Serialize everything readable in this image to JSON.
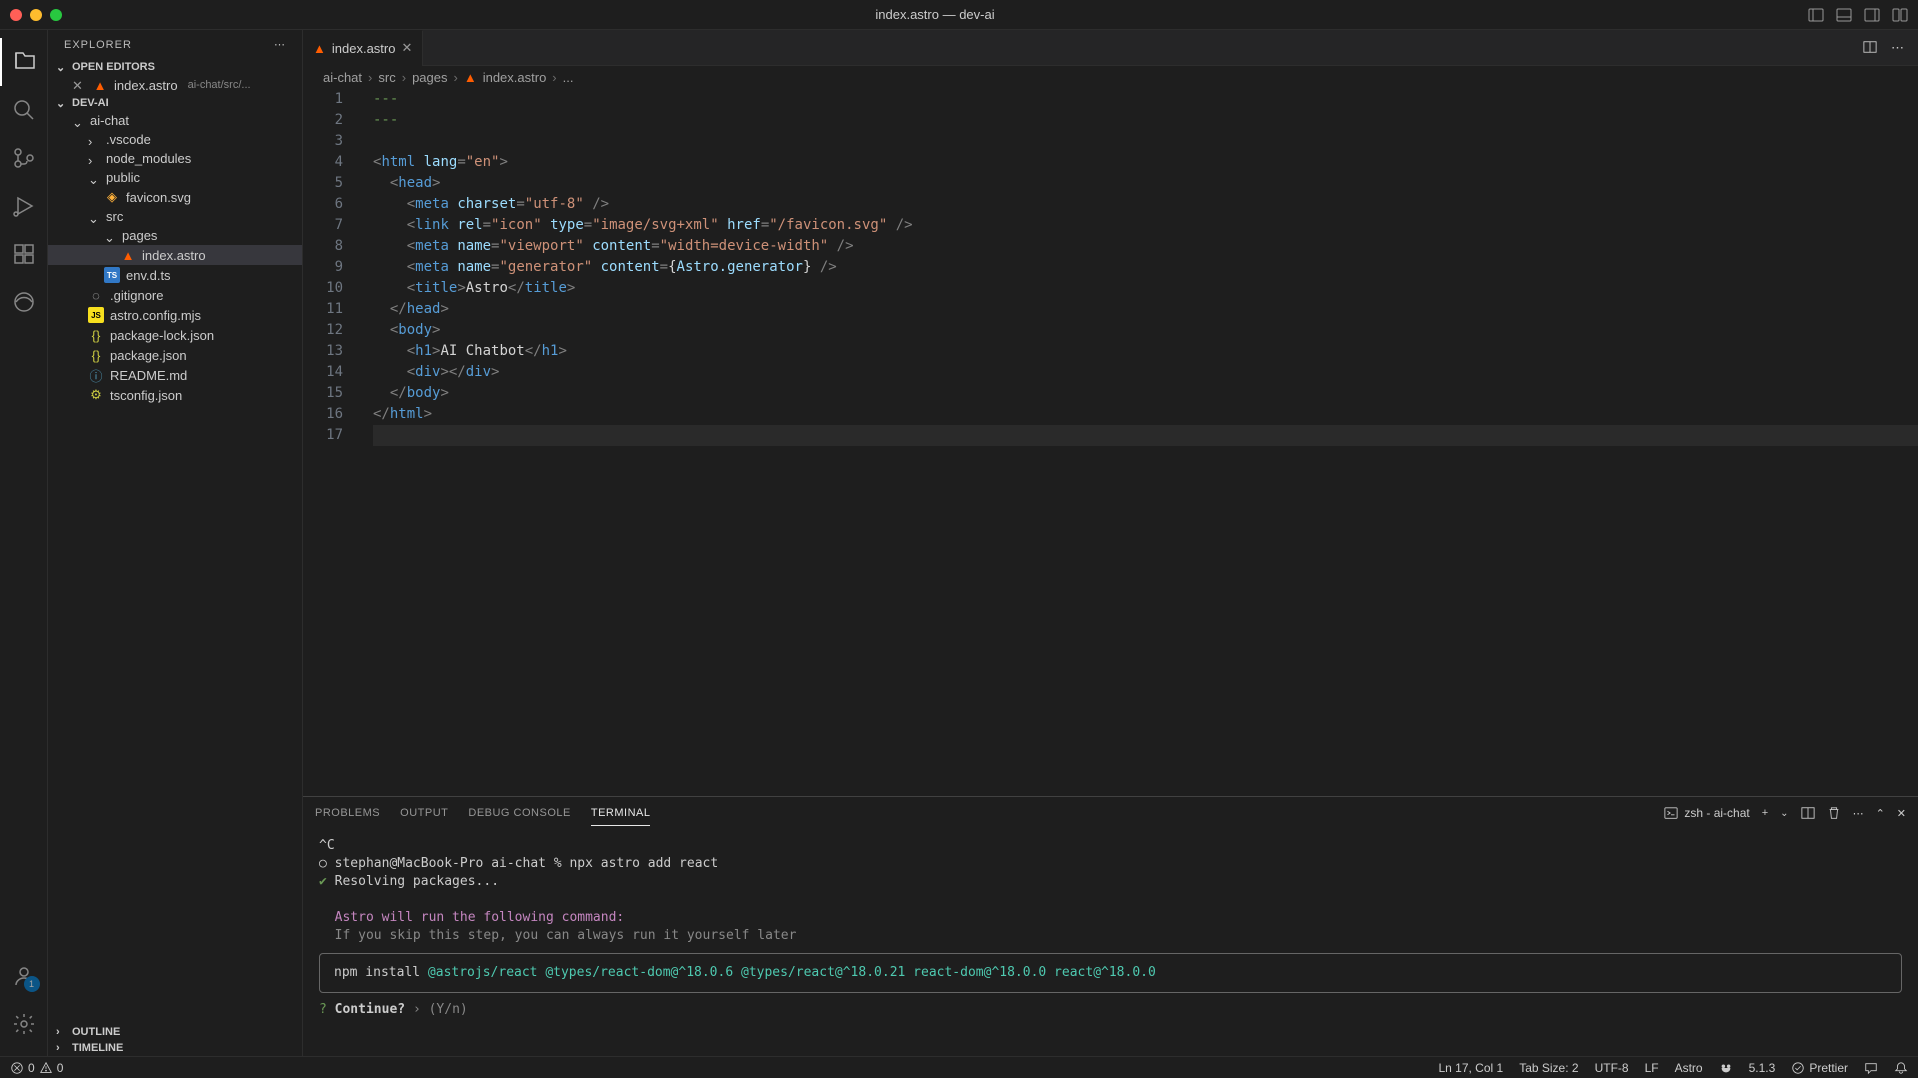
{
  "titlebar": {
    "title": "index.astro — dev-ai"
  },
  "sidebar": {
    "title": "EXPLORER",
    "sections": {
      "open_editors": {
        "label": "OPEN EDITORS",
        "items": [
          {
            "name": "index.astro",
            "path": "ai-chat/src/..."
          }
        ]
      },
      "project": {
        "label": "DEV-AI"
      },
      "outline": {
        "label": "OUTLINE"
      },
      "timeline": {
        "label": "TIMELINE"
      }
    },
    "tree": {
      "root": "ai-chat",
      "folders": {
        "vscode": ".vscode",
        "node_modules": "node_modules",
        "public": "public",
        "src": "src",
        "pages": "pages"
      },
      "files": {
        "favicon": "favicon.svg",
        "index_astro": "index.astro",
        "env_d_ts": "env.d.ts",
        "gitignore": ".gitignore",
        "astro_config": "astro.config.mjs",
        "package_lock": "package-lock.json",
        "package_json": "package.json",
        "readme": "README.md",
        "tsconfig": "tsconfig.json"
      }
    }
  },
  "tabs": [
    {
      "name": "index.astro"
    }
  ],
  "breadcrumb": {
    "parts": [
      "ai-chat",
      "src",
      "pages",
      "index.astro",
      "..."
    ]
  },
  "code": {
    "lines": [
      "---",
      "---",
      "",
      "<html lang=\"en\">",
      "  <head>",
      "    <meta charset=\"utf-8\" />",
      "    <link rel=\"icon\" type=\"image/svg+xml\" href=\"/favicon.svg\" />",
      "    <meta name=\"viewport\" content=\"width=device-width\" />",
      "    <meta name=\"generator\" content={Astro.generator} />",
      "    <title>Astro</title>",
      "  </head>",
      "  <body>",
      "    <h1>AI Chatbot</h1>",
      "    <div></div>",
      "  </body>",
      "</html>",
      ""
    ]
  },
  "panel": {
    "tabs": {
      "problems": "PROBLEMS",
      "output": "OUTPUT",
      "debug": "DEBUG CONSOLE",
      "terminal": "TERMINAL"
    },
    "terminal_name": "zsh - ai-chat"
  },
  "terminal": {
    "interrupt": "^C",
    "prompt_user": "stephan@MacBook-Pro",
    "prompt_dir": "ai-chat",
    "prompt_symbol": "%",
    "command": "npx astro add react",
    "resolving": "Resolving packages...",
    "msg1": "Astro will run the following command:",
    "msg2": "If you skip this step, you can always run it yourself later",
    "npm_cmd": "npm install",
    "packages": "@astrojs/react @types/react-dom@^18.0.6 @types/react@^18.0.21 react-dom@^18.0.0 react@^18.0.0",
    "continue_q": "?",
    "continue_label": "Continue?",
    "continue_hint": "› (Y/n)"
  },
  "statusbar": {
    "errors": "0",
    "warnings": "0",
    "cursor": "Ln 17, Col 1",
    "tab_size": "Tab Size: 2",
    "encoding": "UTF-8",
    "eol": "LF",
    "language": "Astro",
    "version": "5.1.3",
    "prettier": "Prettier",
    "account_badge": "1"
  }
}
